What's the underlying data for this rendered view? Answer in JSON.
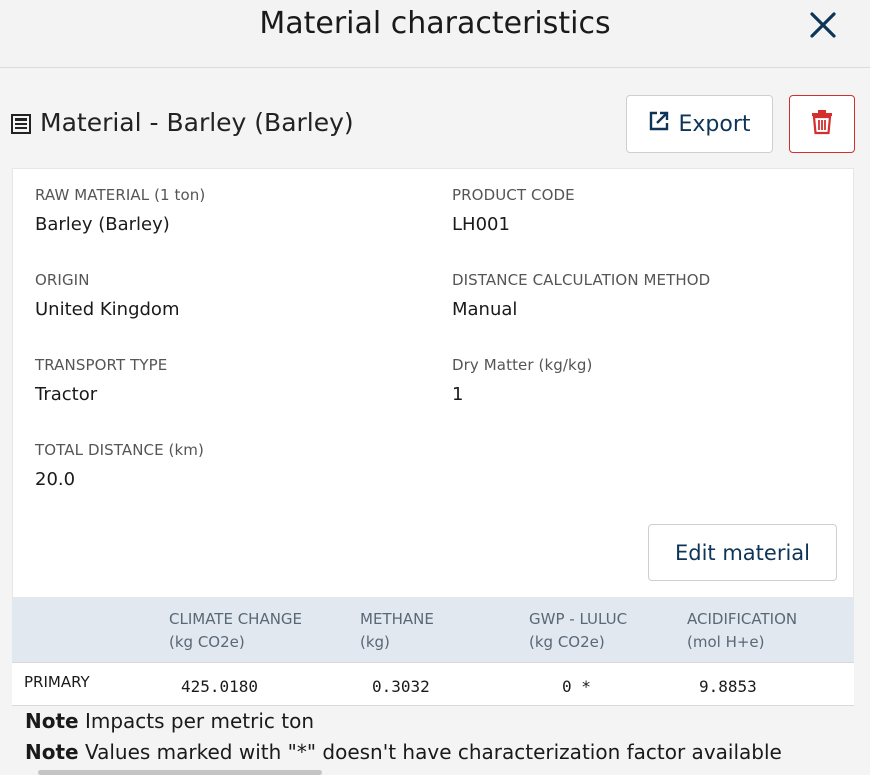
{
  "header": {
    "title": "Material characteristics",
    "close_icon": "close-icon"
  },
  "material": {
    "title": "Material - Barley (Barley)"
  },
  "toolbar": {
    "export_label": "Export",
    "delete_icon": "trash-icon"
  },
  "fields": {
    "raw_material": {
      "label": "RAW MATERIAL (1 ton)",
      "value": "Barley (Barley)"
    },
    "product_code": {
      "label": "PRODUCT CODE",
      "value": "LH001"
    },
    "origin": {
      "label": "ORIGIN",
      "value": "United Kingdom"
    },
    "distance_method": {
      "label": "DISTANCE CALCULATION METHOD",
      "value": "Manual"
    },
    "transport_type": {
      "label": "TRANSPORT TYPE",
      "value": "Tractor"
    },
    "dry_matter": {
      "label": "Dry Matter (kg/kg)",
      "value": "1"
    },
    "total_distance": {
      "label": "TOTAL DISTANCE (km)",
      "value": "20.0"
    }
  },
  "edit_label": "Edit material",
  "table": {
    "headers": [
      {
        "line1": "CLIMATE CHANGE",
        "line2": "(kg CO2e)"
      },
      {
        "line1": "METHANE",
        "line2": "(kg)"
      },
      {
        "line1": "GWP - LULUC",
        "line2": "(kg CO2e)"
      },
      {
        "line1": "ACIDIFICATION",
        "line2": "(mol H+e)"
      }
    ],
    "rows": [
      {
        "label": "PRIMARY",
        "values": [
          "425.0180",
          "0.3032",
          "0 *",
          "9.8853"
        ]
      }
    ]
  },
  "notes": [
    {
      "bold": "Note",
      "text": " Impacts per metric ton"
    },
    {
      "bold": "Note",
      "text": " Values marked with \"*\" doesn't have characterization factor available"
    }
  ],
  "colors": {
    "accent": "#0e3558",
    "danger": "#d32f2f",
    "table_header_bg": "#e1e8ef"
  }
}
